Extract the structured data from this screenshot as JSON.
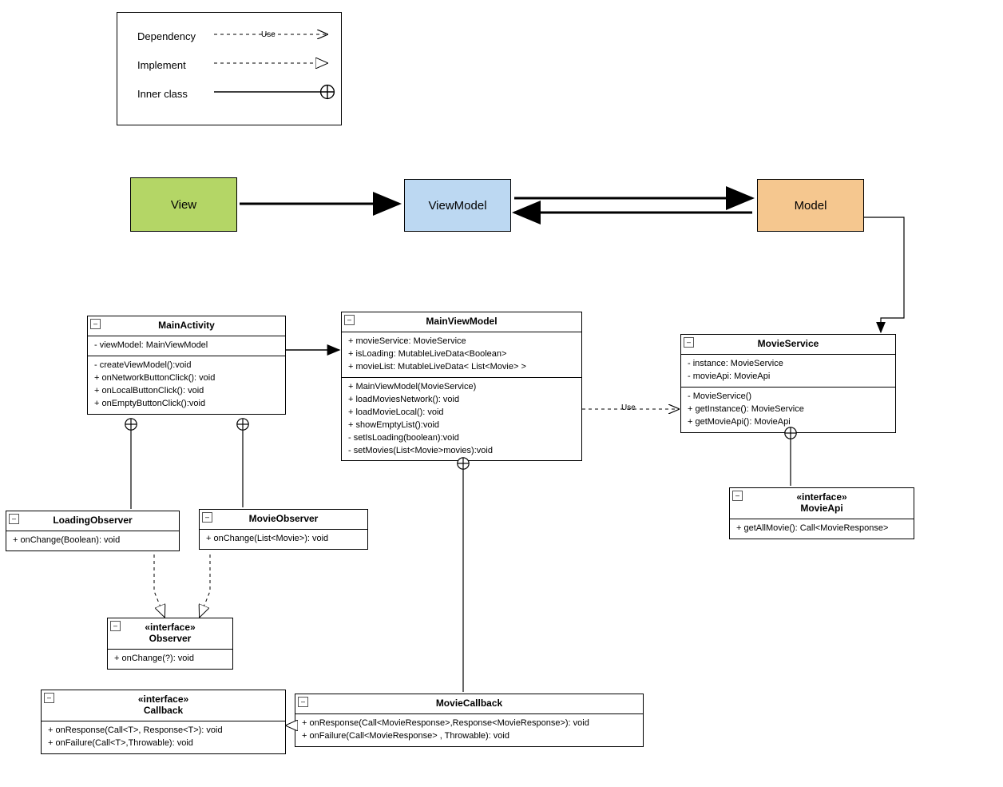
{
  "legend": {
    "dependency": "Dependency",
    "implement": "Implement",
    "innerclass": "Inner class",
    "use": "Use"
  },
  "mvvm": {
    "view": "View",
    "viewmodel": "ViewModel",
    "model": "Model"
  },
  "classes": {
    "mainactivity": {
      "name": "MainActivity",
      "attrs": "- viewModel: MainViewModel",
      "ops": "- createViewModel():void\n+ onNetworkButtonClick(): void\n+ onLocalButtonClick(): void\n+ onEmptyButtonClick():void"
    },
    "mainviewmodel": {
      "name": "MainViewModel",
      "attrs": "+ movieService: MovieService\n+ isLoading: MutableLiveData<Boolean>\n+ movieList: MutableLiveData< List<Movie> >",
      "ops": "+ MainViewModel(MovieService)\n+ loadMoviesNetwork(): void\n+ loadMovieLocal(): void\n+ showEmptyList():void\n- setIsLoading(boolean):void\n- setMovies(List<Movie>movies):void"
    },
    "movieservice": {
      "name": "MovieService",
      "attrs": "- instance: MovieService\n- movieApi: MovieApi",
      "ops": "- MovieService()\n+ getInstance(): MovieService\n+ getMovieApi(): MovieApi"
    },
    "loadingobserver": {
      "name": "LoadingObserver",
      "ops": "+ onChange(Boolean): void"
    },
    "movieobserver": {
      "name": "MovieObserver",
      "ops": "+ onChange(List<Movie>): void"
    },
    "observer": {
      "stereo": "«interface»",
      "name": "Observer",
      "ops": "+ onChange(?): void"
    },
    "movieapi": {
      "stereo": "«interface»",
      "name": "MovieApi",
      "ops": "+ getAllMovie(): Call<MovieResponse>"
    },
    "moviecallback": {
      "name": "MovieCallback",
      "ops": "+ onResponse(Call<MovieResponse>,Response<MovieResponse>): void\n+ onFailure(Call<MovieResponse> , Throwable): void"
    },
    "callback": {
      "stereo": "«interface»",
      "name": "Callback",
      "ops": "+ onResponse(Call<T>, Response<T>): void\n+ onFailure(Call<T>,Throwable): void"
    }
  },
  "labels": {
    "use": "Use"
  }
}
